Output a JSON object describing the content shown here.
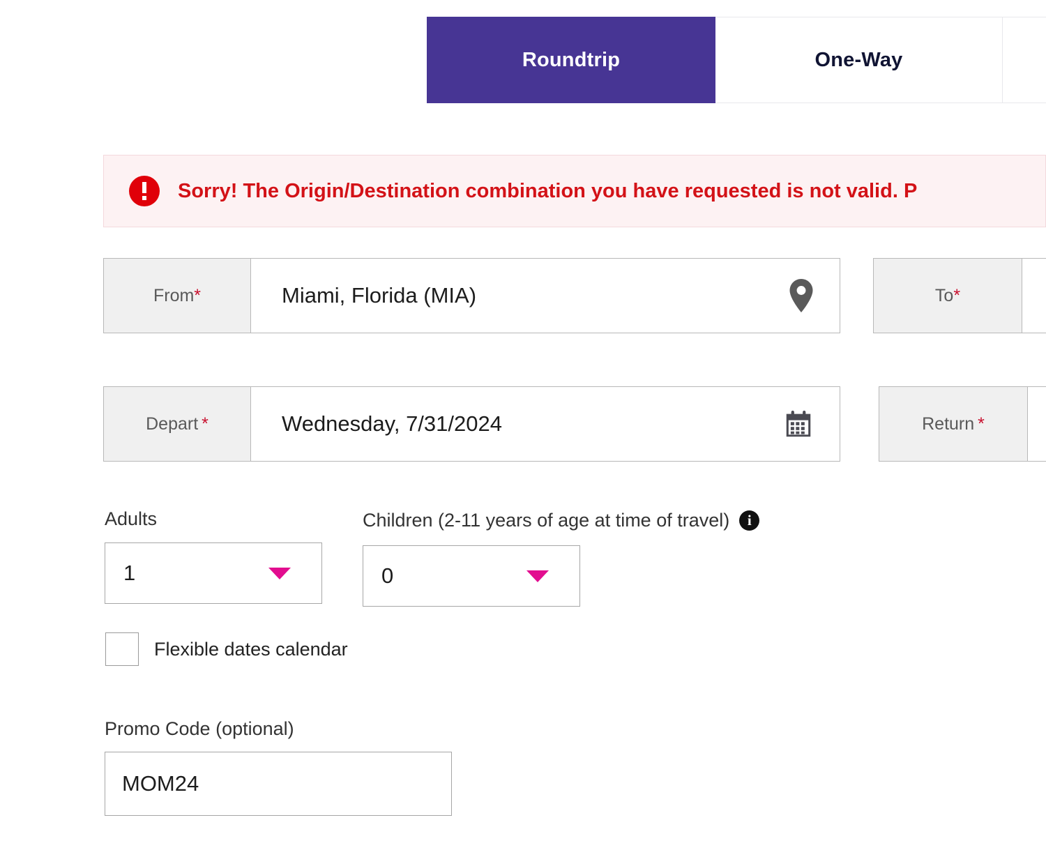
{
  "tabs": [
    {
      "label": "Roundtrip",
      "state": "active"
    },
    {
      "label": "One-Way",
      "state": "inactive"
    }
  ],
  "error": {
    "icon": "error-exclamation-icon",
    "message": "Sorry! The Origin/Destination combination you have requested is not valid. P"
  },
  "form": {
    "from": {
      "label": "From",
      "required_marker": "*",
      "value": "Miami, Florida (MIA)",
      "icon": "location-pin-icon"
    },
    "to": {
      "label": "To",
      "required_marker": "*",
      "value": ""
    },
    "depart": {
      "label": "Depart",
      "required_marker": "*",
      "value": "Wednesday, 7/31/2024",
      "icon": "calendar-icon"
    },
    "return": {
      "label": "Return",
      "required_marker": "*",
      "value": ""
    },
    "adults": {
      "label": "Adults",
      "value": "1"
    },
    "children": {
      "label": "Children (2-11 years of age at time of travel)",
      "value": "0",
      "info_icon": "info-icon"
    },
    "flexible_dates": {
      "label": "Flexible dates calendar",
      "checked": false
    },
    "promo": {
      "label": "Promo Code (optional)",
      "value": "MOM24"
    }
  },
  "colors": {
    "tab_active_bg": "#473594",
    "error_text": "#d31217",
    "error_bg": "#fdf2f3",
    "error_icon": "#e00009",
    "caret": "#e20d8f",
    "required": "#c8102e"
  }
}
